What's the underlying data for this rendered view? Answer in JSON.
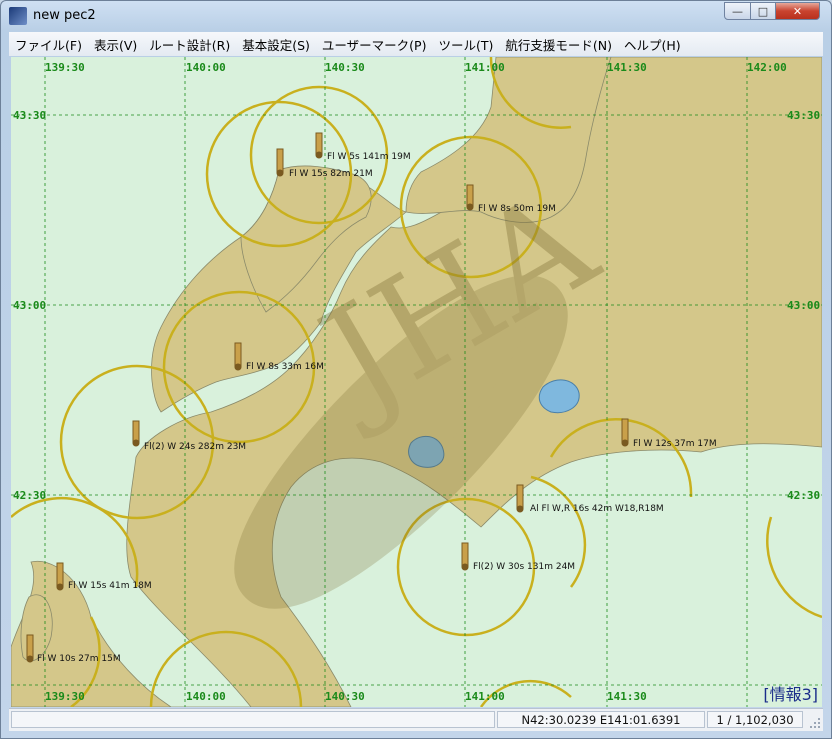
{
  "window": {
    "title": "new pec2"
  },
  "menu": [
    "ファイル(F)",
    "表示(V)",
    "ルート設計(R)",
    "基本設定(S)",
    "ユーザーマーク(P)",
    "ツール(T)",
    "航行支援モード(N)",
    "ヘルプ(H)"
  ],
  "map": {
    "top_lon_labels": [
      "139:30",
      "140:00",
      "140:30",
      "141:00",
      "141:30",
      "142:00"
    ],
    "bottom_lon_labels": [
      "139:30",
      "140:00",
      "140:30",
      "141:00",
      "141:30"
    ],
    "lat_labels_left": [
      "43:30",
      "43:00",
      "42:30"
    ],
    "lat_labels_right": [
      "43:30",
      "43:00",
      "42:30"
    ],
    "lights": [
      "Fl W 5s 141m 19M",
      "Fl W 15s 82m 21M",
      "Fl W 8s 50m 19M",
      "Fl W 8s 33m 16M",
      "Fl(2) W 24s 282m 23M",
      "Fl W 12s 37m 17M",
      "Al Fl W,R 16s 42m W18,R18M",
      "Fl(2) W 30s 131m 24M",
      "Fl W 15s 41m 18M",
      "Fl W 10s 27m 15M"
    ],
    "info_tag": "[情報3]",
    "colors": {
      "sea": "#d9f1dc",
      "land": "#d4c78a",
      "lake": "#7fb8de",
      "grid": "#1a8a1a",
      "light_arc": "#c9b01e"
    }
  },
  "status": {
    "coords": "N42:30.0239 E141:01.6391",
    "scale": "1 / 1,102,030"
  }
}
